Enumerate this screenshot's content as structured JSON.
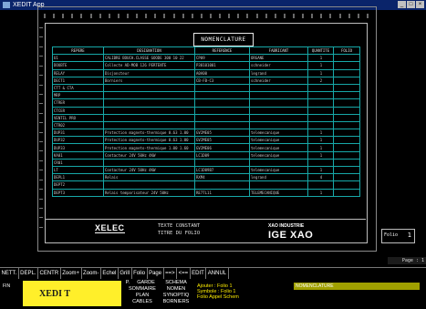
{
  "window": {
    "title": "XEDIT App"
  },
  "nomenclature": {
    "title": "NOMENCLATURE",
    "columns": [
      "REPERE",
      "DESIGNATION",
      "REFERENCE",
      "FABRICANT",
      "QUANTITE",
      "FOLIO"
    ],
    "rows": [
      [
        "U1",
        "CALIBRE BOUCH.CLASSE GOODE 300 10 22",
        "CP09",
        "ORGANE",
        "1",
        ""
      ],
      [
        "DOUBTE",
        "Collecte AD-MOB 126 PERTENTE",
        "P30101001",
        "schneider",
        "1",
        ""
      ],
      [
        "RELAY",
        "Disjoncteur",
        "A0A00",
        "legrand",
        "1",
        ""
      ],
      [
        "DECT1",
        "Borniers",
        "CB-FB-C3",
        "schneider",
        "2",
        ""
      ],
      [
        "CTT & CTA",
        "",
        "",
        "",
        "",
        ""
      ],
      [
        "MRP",
        "",
        "",
        "",
        "",
        ""
      ],
      [
        "CTRER",
        "",
        "",
        "",
        "",
        ""
      ],
      [
        "CTCER",
        "",
        "",
        "",
        "",
        ""
      ],
      [
        "VENTIL PRO",
        "",
        "",
        "",
        "",
        ""
      ],
      [
        "CTR02",
        "",
        "",
        "",
        "",
        ""
      ],
      [
        "DUP31",
        "Protection magneto-thermique 0.63 1.00",
        "GV2ME05",
        "telemecanique",
        "1",
        ""
      ],
      [
        "DUP32",
        "Protection magneto-thermique 0.63 1.00",
        "GV2ME05",
        "telemecanique",
        "1",
        ""
      ],
      [
        "DUP33",
        "Protection magneto-thermique 1.00 1.60",
        "GV2ME06",
        "telemecanique",
        "1",
        ""
      ],
      [
        "KA01",
        "Contacteur 24V 50Hz 4KW",
        "LC1D09",
        "telemecanique",
        "1",
        ""
      ],
      [
        "CR01",
        "",
        "",
        "",
        "",
        ""
      ],
      [
        "LT",
        "Contacteur 24V 50Hz 4KW",
        "LC1D09B7",
        "telemecanique",
        "1",
        ""
      ],
      [
        "DEPL1",
        "Relais",
        "RXM4",
        "legrand",
        "4",
        ""
      ],
      [
        "DEPT2",
        "",
        "",
        "",
        "",
        ""
      ],
      [
        "DEPT3",
        "Relais temporisateur 24V 50Hz",
        "RE7TL11",
        "TELEMECANIQUE",
        "1",
        ""
      ]
    ]
  },
  "cartouche": {
    "logo": "XELEC",
    "line1": "TEXTE CONSTANT",
    "line2": "TITRE DU FOLIO",
    "brand_small": "XAO INDUSTRIE",
    "brand_big": "IGE XAO",
    "folio_label": "Folio",
    "folio_value": "1"
  },
  "page_indicator": "Page : 1",
  "menubar": [
    "NETT.",
    "DEPL.",
    "CENTR",
    "Zoom+",
    "Zoom-",
    "Echel",
    "Grill",
    "Folio",
    "Page",
    "==>",
    "<==",
    "EDIT",
    "ANNUL"
  ],
  "bottom": {
    "fin_label": "FIN",
    "app_name": "XEDI T",
    "menu": {
      "r1c1": "P.",
      "r1c2": "GARDE",
      "r1c3": "SCHEMA",
      "r2c1": "SOMMAIRE",
      "r2c2": "NOMEN",
      "r3c1": "PLAN",
      "r3c2": "SYNOPTIQ",
      "r4c1": "CABLES",
      "r4c2": "BORNIERS"
    },
    "messages": [
      "Ajouter : Folio 1",
      "Symbole : Folio 1",
      "Folio Appel Schem"
    ],
    "status": "NOMENCLATURE"
  }
}
